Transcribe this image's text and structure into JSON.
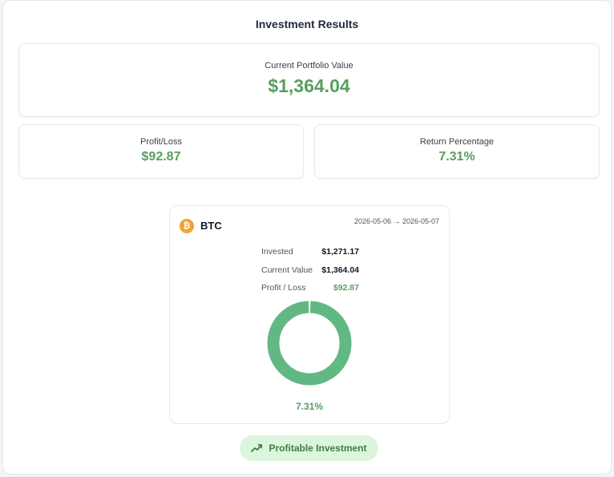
{
  "title": "Investment Results",
  "portfolio": {
    "label": "Current Portfolio Value",
    "value": "$1,364.04"
  },
  "profit_loss": {
    "label": "Profit/Loss",
    "value": "$92.87"
  },
  "return_pct": {
    "label": "Return Percentage",
    "value": "7.31%"
  },
  "asset": {
    "icon": "bitcoin-icon",
    "icon_glyph": "₿",
    "name": "BTC",
    "date_range": "2026-05-06 → 2026-05-07",
    "rows": [
      {
        "label": "Invested",
        "value": "$1,271.17"
      },
      {
        "label": "Current Value",
        "value": "$1,364.04"
      },
      {
        "label": "Profit / Loss",
        "value": "$92.87"
      }
    ],
    "return_text": "7.31%",
    "donut": {
      "profit_fraction": 0.0731,
      "invested_fraction": 0.9269
    }
  },
  "badge": {
    "icon": "trending-up-icon",
    "label": "Profitable Investment"
  },
  "colors": {
    "positive": "#5a9e5f",
    "donut_main": "#62b884",
    "donut_segment": "#ffffff",
    "bitcoin": "#f0a236",
    "badge_bg": "#dcf5dd",
    "badge_text": "#3e7d45"
  }
}
